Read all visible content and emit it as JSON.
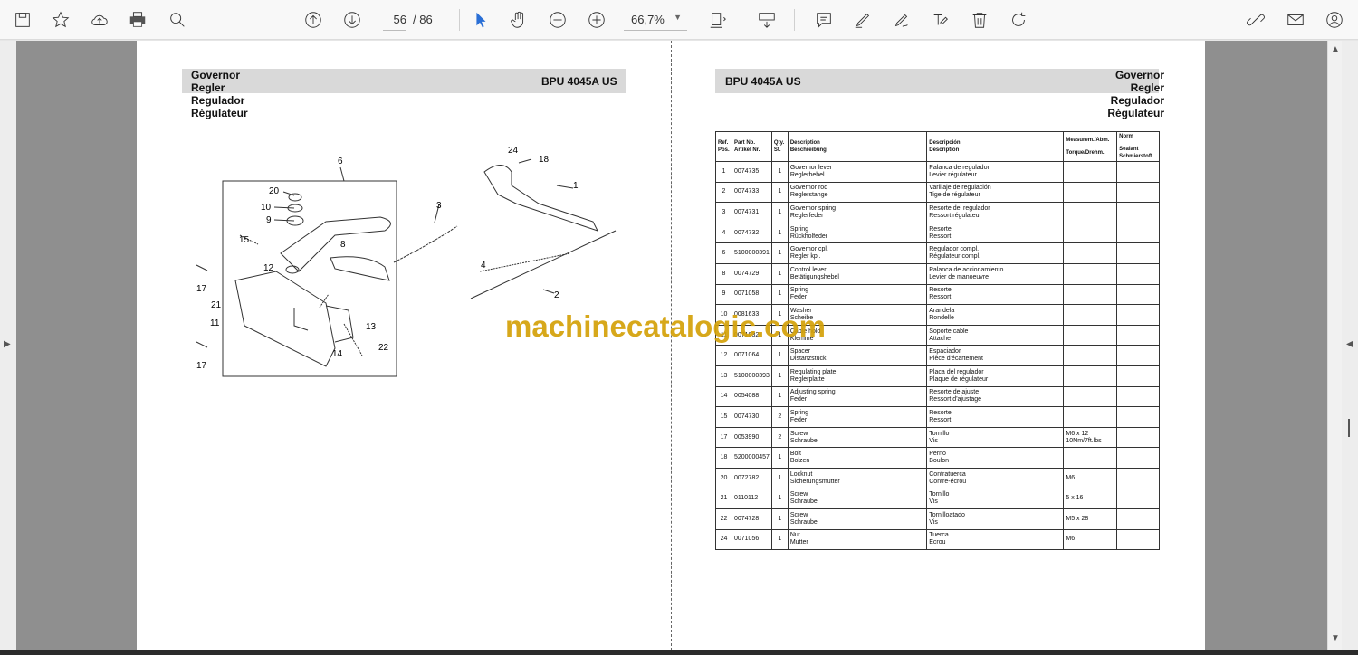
{
  "toolbar": {
    "page_current": "56",
    "page_total": "/ 86",
    "zoom": "66,7%"
  },
  "left": {
    "titles": [
      "Governor",
      "Regler",
      "Regulador",
      "Régulateur"
    ],
    "model": "BPU 4045A US",
    "callouts": [
      "6",
      "24",
      "18",
      "20",
      "10",
      "9",
      "1",
      "3",
      "15",
      "8",
      "12",
      "17",
      "4",
      "21",
      "11",
      "2",
      "13",
      "22",
      "14",
      "17"
    ]
  },
  "right": {
    "model": "BPU 4045A US",
    "titles": [
      "Governor",
      "Regler",
      "Regulador",
      "Régulateur"
    ],
    "columns": {
      "ref": [
        "Ref.",
        "Pos."
      ],
      "part": [
        "Part No.",
        "Artikel Nr."
      ],
      "qty": [
        "Qty.",
        "St."
      ],
      "desc": [
        "Description",
        "Beschreibung"
      ],
      "desc2": [
        "Descripción",
        "Description"
      ],
      "measure": [
        "Measurem./Abm.",
        "Torque/Drehm."
      ],
      "norm": [
        "Norm",
        "Sealant Schmierstoff"
      ]
    },
    "rows": [
      {
        "pos": "1",
        "part": "0074735",
        "qty": "1",
        "d1": "Governor lever",
        "d2": "Reglerhebel",
        "s1": "Palanca de regulador",
        "s2": "Levier régulateur",
        "m": "",
        "n": ""
      },
      {
        "pos": "2",
        "part": "0074733",
        "qty": "1",
        "d1": "Governor rod",
        "d2": "Reglerstange",
        "s1": "Varillaje de regulación",
        "s2": "Tige de régulateur",
        "m": "",
        "n": ""
      },
      {
        "pos": "3",
        "part": "0074731",
        "qty": "1",
        "d1": "Governor spring",
        "d2": "Reglerfeder",
        "s1": "Resorte del regulador",
        "s2": "Ressort régulateur",
        "m": "",
        "n": ""
      },
      {
        "pos": "4",
        "part": "0074732",
        "qty": "1",
        "d1": "Spring",
        "d2": "Rückholfeder",
        "s1": "Resorte",
        "s2": "Ressort",
        "m": "",
        "n": ""
      },
      {
        "pos": "6",
        "part": "5100000391",
        "qty": "1",
        "d1": "Governor cpl.",
        "d2": "Regler kpl.",
        "s1": "Regulador compl.",
        "s2": "Régulateur compl.",
        "m": "",
        "n": ""
      },
      {
        "pos": "8",
        "part": "0074729",
        "qty": "1",
        "d1": "Control lever",
        "d2": "Betätigungshebel",
        "s1": "Palanca de accionamiento",
        "s2": "Levier de manoeuvre",
        "m": "",
        "n": ""
      },
      {
        "pos": "9",
        "part": "0071058",
        "qty": "1",
        "d1": "Spring",
        "d2": "Feder",
        "s1": "Resorte",
        "s2": "Ressort",
        "m": "",
        "n": ""
      },
      {
        "pos": "10",
        "part": "0081633",
        "qty": "1",
        "d1": "Washer",
        "d2": "Scheibe",
        "s1": "Arandela",
        "s2": "Rondelle",
        "m": "",
        "n": ""
      },
      {
        "pos": "11",
        "part": "0071032",
        "qty": "1",
        "d1": "Cable hold",
        "d2": "Klemme",
        "s1": "Soporte cable",
        "s2": "Attache",
        "m": "",
        "n": ""
      },
      {
        "pos": "12",
        "part": "0071064",
        "qty": "1",
        "d1": "Spacer",
        "d2": "Distanzstück",
        "s1": "Espaciador",
        "s2": "Pièce d'écartement",
        "m": "",
        "n": ""
      },
      {
        "pos": "13",
        "part": "5100000393",
        "qty": "1",
        "d1": "Regulating plate",
        "d2": "Reglerplatte",
        "s1": "Placa del regulador",
        "s2": "Plaque de régulateur",
        "m": "",
        "n": ""
      },
      {
        "pos": "14",
        "part": "0054088",
        "qty": "1",
        "d1": "Adjusting spring",
        "d2": "Feder",
        "s1": "Resorte de ajuste",
        "s2": "Ressort d'ajustage",
        "m": "",
        "n": ""
      },
      {
        "pos": "15",
        "part": "0074730",
        "qty": "2",
        "d1": "Spring",
        "d2": "Feder",
        "s1": "Resorte",
        "s2": "Ressort",
        "m": "",
        "n": ""
      },
      {
        "pos": "17",
        "part": "0053990",
        "qty": "2",
        "d1": "Screw",
        "d2": "Schraube",
        "s1": "Tornillo",
        "s2": "Vis",
        "m": "M6 x 12",
        "m2": "10Nm/7ft.lbs",
        "n": ""
      },
      {
        "pos": "18",
        "part": "5200000457",
        "qty": "1",
        "d1": "Bolt",
        "d2": "Bolzen",
        "s1": "Perno",
        "s2": "Boulon",
        "m": "",
        "n": ""
      },
      {
        "pos": "20",
        "part": "0072782",
        "qty": "1",
        "d1": "Locknut",
        "d2": "Sicherungsmutter",
        "s1": "Contratuerca",
        "s2": "Contre-écrou",
        "m": "M6",
        "n": ""
      },
      {
        "pos": "21",
        "part": "0110112",
        "qty": "1",
        "d1": "Screw",
        "d2": "Schraube",
        "s1": "Tornillo",
        "s2": "Vis",
        "m": "5 x 16",
        "n": ""
      },
      {
        "pos": "22",
        "part": "0074728",
        "qty": "1",
        "d1": "Screw",
        "d2": "Schraube",
        "s1": "Tornilloatado",
        "s2": "Vis",
        "m": "M5 x 28",
        "n": ""
      },
      {
        "pos": "24",
        "part": "0071056",
        "qty": "1",
        "d1": "Nut",
        "d2": "Mutter",
        "s1": "Tuerca",
        "s2": "Ecrou",
        "m": "M6",
        "n": ""
      }
    ]
  },
  "watermark": "machinecatalogic.com"
}
